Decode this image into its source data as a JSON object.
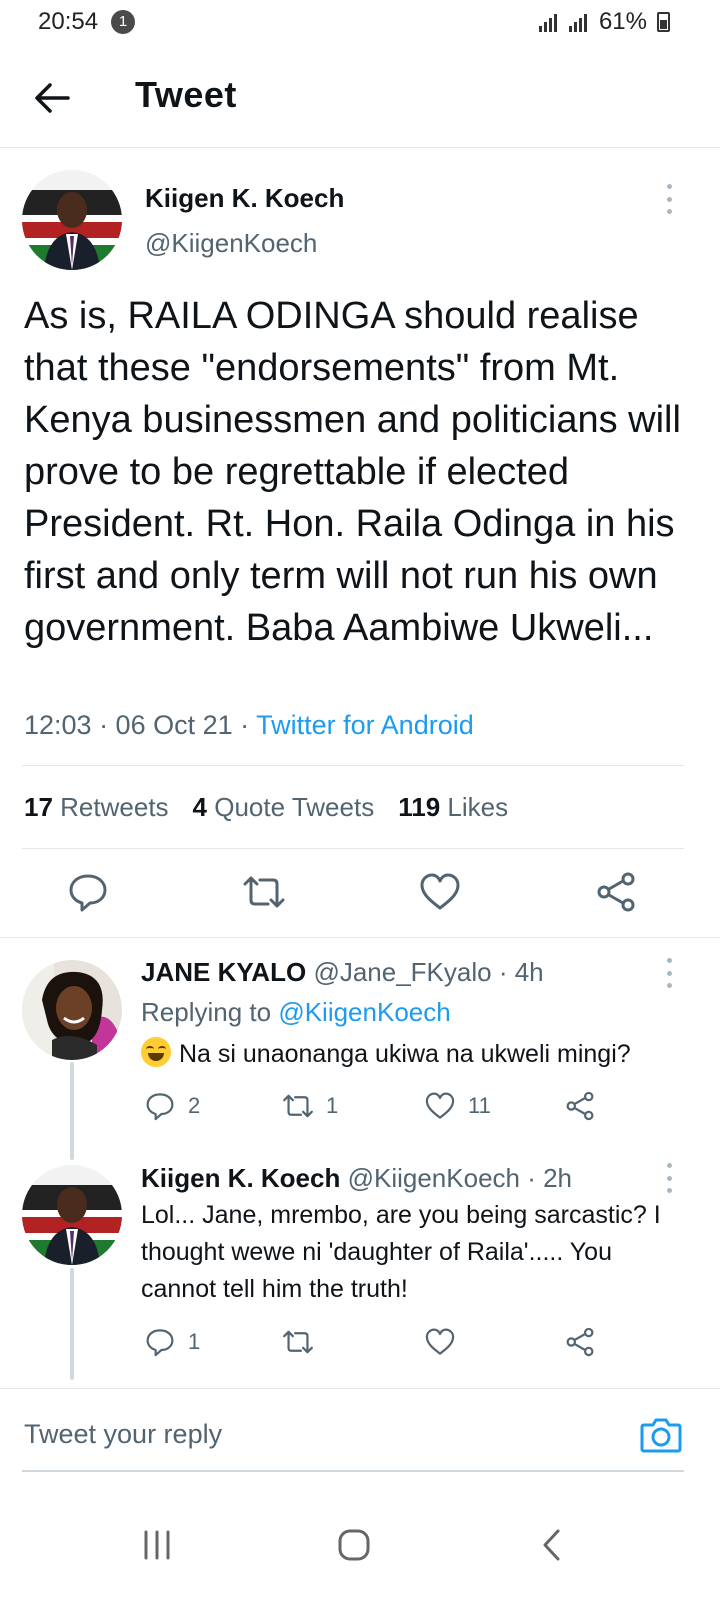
{
  "status_bar": {
    "time": "20:54",
    "notification_count": "1",
    "battery": "61%"
  },
  "header": {
    "title": "Tweet"
  },
  "tweet": {
    "author_name": "Kiigen K. Koech",
    "author_handle": "@KiigenKoech",
    "text": "As is, RAILA ODINGA should realise that these \"endorsements\" from Mt. Kenya businessmen and politicians will prove to be regrettable if elected President. Rt. Hon. Raila Odinga in his first and only term will not run his own government. Baba Aambiwe Ukweli...",
    "timestamp": "12:03 · 06 Oct 21 · ",
    "source": "Twitter for Android",
    "retweets_count": "17",
    "retweets_label": "Retweets",
    "quotes_count": "4",
    "quotes_label": "Quote Tweets",
    "likes_count": "119",
    "likes_label": "Likes"
  },
  "replies": [
    {
      "name": "JANE KYALO",
      "handle": "@Jane_FKyalo",
      "time": " · 4h",
      "replying_prefix": "Replying to ",
      "replying_to": "@KiigenKoech",
      "text": "Na si unaonanga ukiwa na ukweli mingi?",
      "reply_count": "2",
      "retweet_count": "1",
      "like_count": "11"
    },
    {
      "name": "Kiigen K. Koech",
      "handle": "@KiigenKoech",
      "time": " · 2h",
      "text": "Lol... Jane, mrembo, are you being sarcastic? I thought wewe ni 'daughter of Raila'..... You cannot tell him the truth!",
      "reply_count": "1",
      "retweet_count": "",
      "like_count": ""
    }
  ],
  "reply_box": {
    "placeholder": "Tweet your reply"
  },
  "colors": {
    "accent": "#1d9bf0",
    "secondary_text": "#536471",
    "primary_text": "#0f1419",
    "divider": "#e4e7ea"
  },
  "icons": [
    "back-arrow-icon",
    "more-icon",
    "reply-icon",
    "retweet-icon",
    "like-icon",
    "share-icon",
    "camera-icon",
    "recent-apps-icon",
    "home-icon",
    "back-icon"
  ]
}
